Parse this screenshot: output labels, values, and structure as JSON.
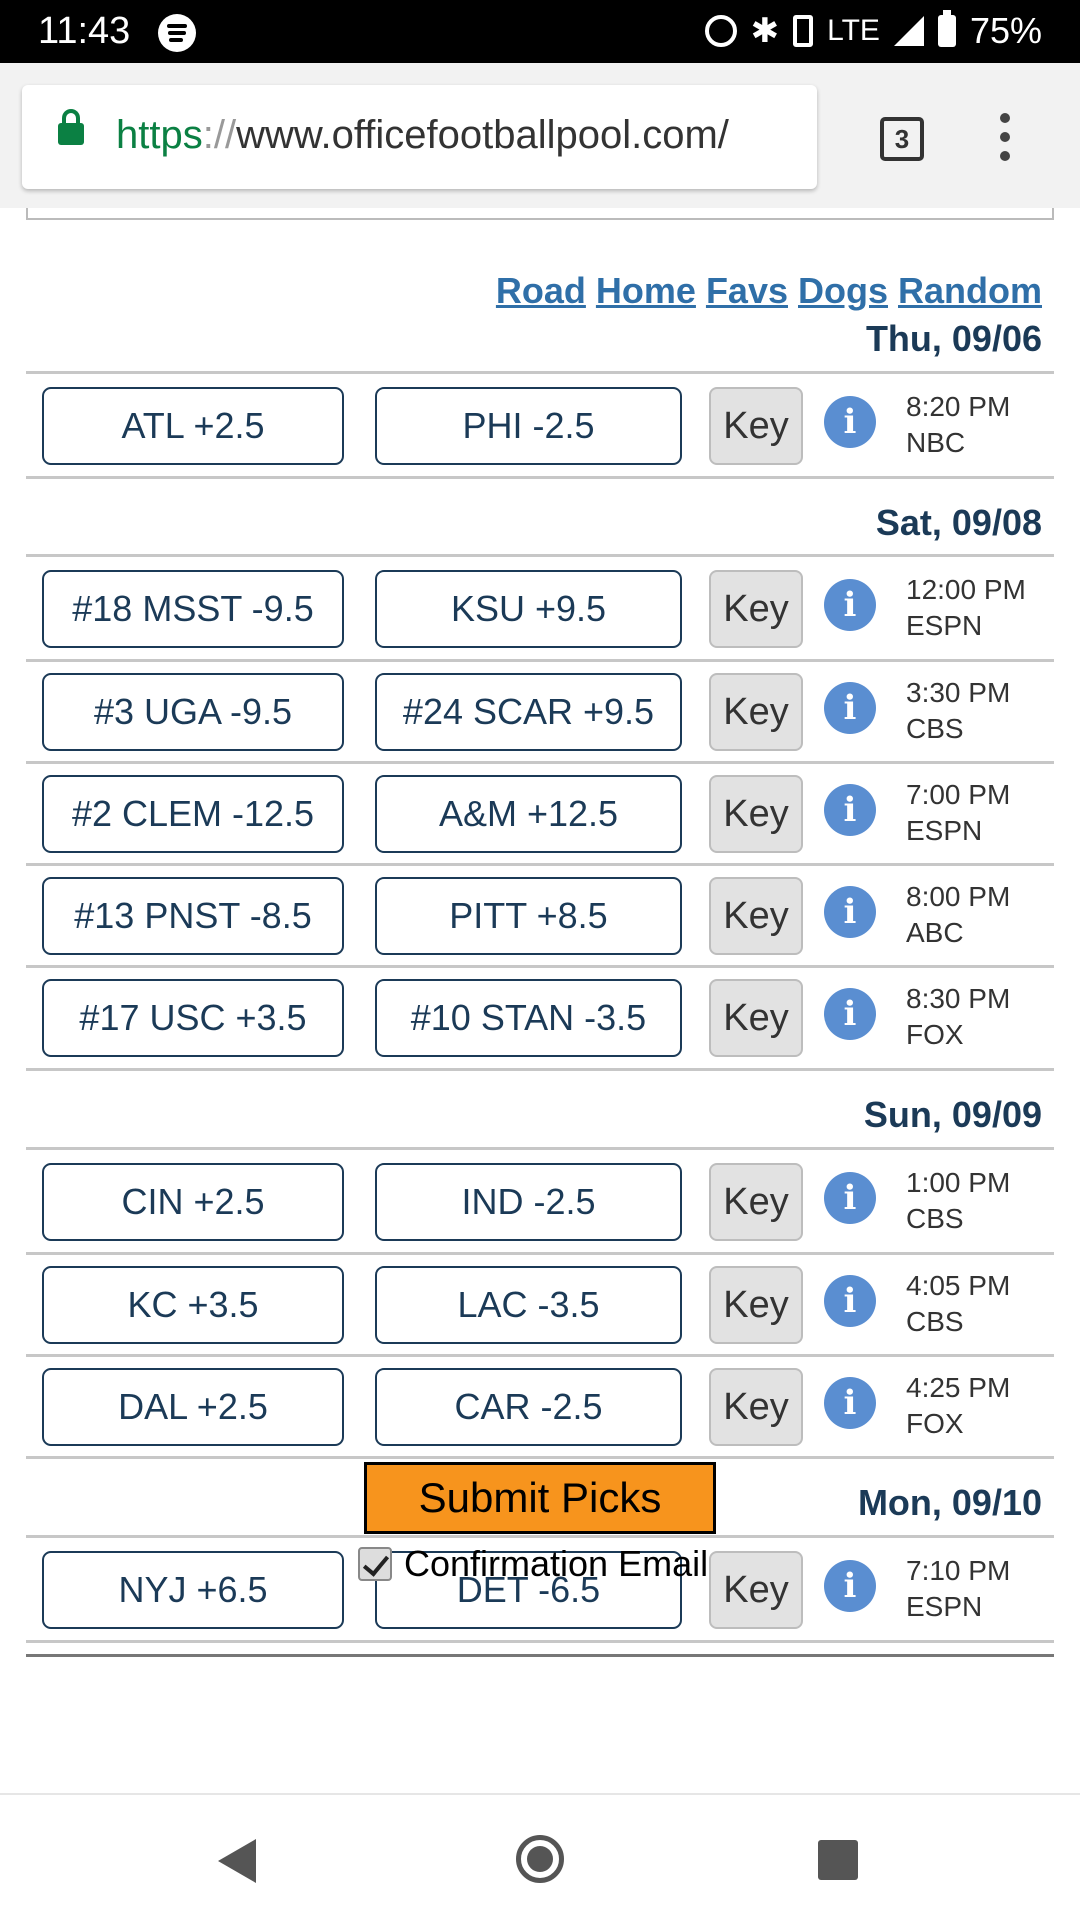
{
  "status_bar": {
    "time": "11:43",
    "network": "LTE",
    "battery": "75%",
    "icons": [
      "spotify-icon",
      "alarm-icon",
      "bluetooth-icon",
      "vibrate-icon",
      "signal-icon",
      "battery-icon"
    ]
  },
  "browser": {
    "url_scheme": "https",
    "url_separator": "://",
    "url_host": "www.officefootballpool.com/",
    "tab_count": "3"
  },
  "sort_links": [
    "Road",
    "Home",
    "Favs",
    "Dogs",
    "Random"
  ],
  "days": [
    {
      "date": "Thu, 09/06",
      "games": [
        {
          "away": "ATL +2.5",
          "home": "PHI -2.5",
          "key": "Key",
          "time": "8:20 PM",
          "network": "NBC"
        }
      ]
    },
    {
      "date": "Sat, 09/08",
      "games": [
        {
          "away": "#18 MSST -9.5",
          "home": "KSU +9.5",
          "key": "Key",
          "time": "12:00 PM",
          "network": "ESPN"
        },
        {
          "away": "#3 UGA -9.5",
          "home": "#24 SCAR +9.5",
          "key": "Key",
          "time": "3:30 PM",
          "network": "CBS"
        },
        {
          "away": "#2 CLEM -12.5",
          "home": "A&M +12.5",
          "key": "Key",
          "time": "7:00 PM",
          "network": "ESPN"
        },
        {
          "away": "#13 PNST -8.5",
          "home": "PITT +8.5",
          "key": "Key",
          "time": "8:00 PM",
          "network": "ABC"
        },
        {
          "away": "#17 USC +3.5",
          "home": "#10 STAN -3.5",
          "key": "Key",
          "time": "8:30 PM",
          "network": "FOX"
        }
      ]
    },
    {
      "date": "Sun, 09/09",
      "games": [
        {
          "away": "CIN +2.5",
          "home": "IND -2.5",
          "key": "Key",
          "time": "1:00 PM",
          "network": "CBS"
        },
        {
          "away": "KC +3.5",
          "home": "LAC -3.5",
          "key": "Key",
          "time": "4:05 PM",
          "network": "CBS"
        },
        {
          "away": "DAL +2.5",
          "home": "CAR -2.5",
          "key": "Key",
          "time": "4:25 PM",
          "network": "FOX"
        }
      ]
    },
    {
      "date": "Mon, 09/10",
      "games": [
        {
          "away": "NYJ +6.5",
          "home": "DET -6.5",
          "key": "Key",
          "time": "7:10 PM",
          "network": "ESPN"
        }
      ]
    }
  ],
  "info_glyph": "i",
  "submit_label": "Submit Picks",
  "confirmation": {
    "label": "Confirmation Email",
    "checked": true
  },
  "colors": {
    "accent_orange": "#f7941d",
    "team_navy": "#1b3a57",
    "link_blue": "#2f6fa8",
    "info_blue": "#5a8ed1"
  }
}
